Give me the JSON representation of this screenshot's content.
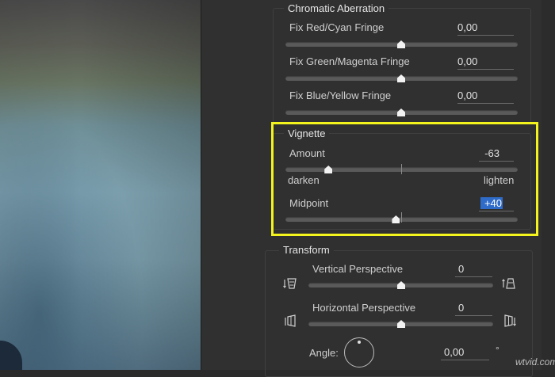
{
  "chromatic_aberration": {
    "title": "Chromatic Aberration",
    "rows": [
      {
        "label": "Fix Red/Cyan Fringe",
        "value": "0,00",
        "level": 0.5
      },
      {
        "label": "Fix Green/Magenta Fringe",
        "value": "0,00",
        "level": 0.5
      },
      {
        "label": "Fix Blue/Yellow Fringe",
        "value": "0,00",
        "level": 0.5
      }
    ]
  },
  "vignette": {
    "title": "Vignette",
    "amount": {
      "label": "Amount",
      "value": "-63",
      "range_min": -100,
      "range_max": 100,
      "level": -63
    },
    "amount_left_hint": "darken",
    "amount_right_hint": "lighten",
    "midpoint": {
      "label": "Midpoint",
      "value": "+40",
      "range_min": 0,
      "range_max": 100,
      "level": 40
    }
  },
  "transform": {
    "title": "Transform",
    "vertical": {
      "label": "Vertical Perspective",
      "value": "0",
      "level": 0.5
    },
    "horizontal": {
      "label": "Horizontal Perspective",
      "value": "0",
      "level": 0.5
    },
    "angle": {
      "label": "Angle:",
      "value": "0,00",
      "unit": "°"
    }
  },
  "highlight_color": "#f3f31e",
  "selection_color": "#2f6bc9",
  "watermark": "wtvid.com"
}
